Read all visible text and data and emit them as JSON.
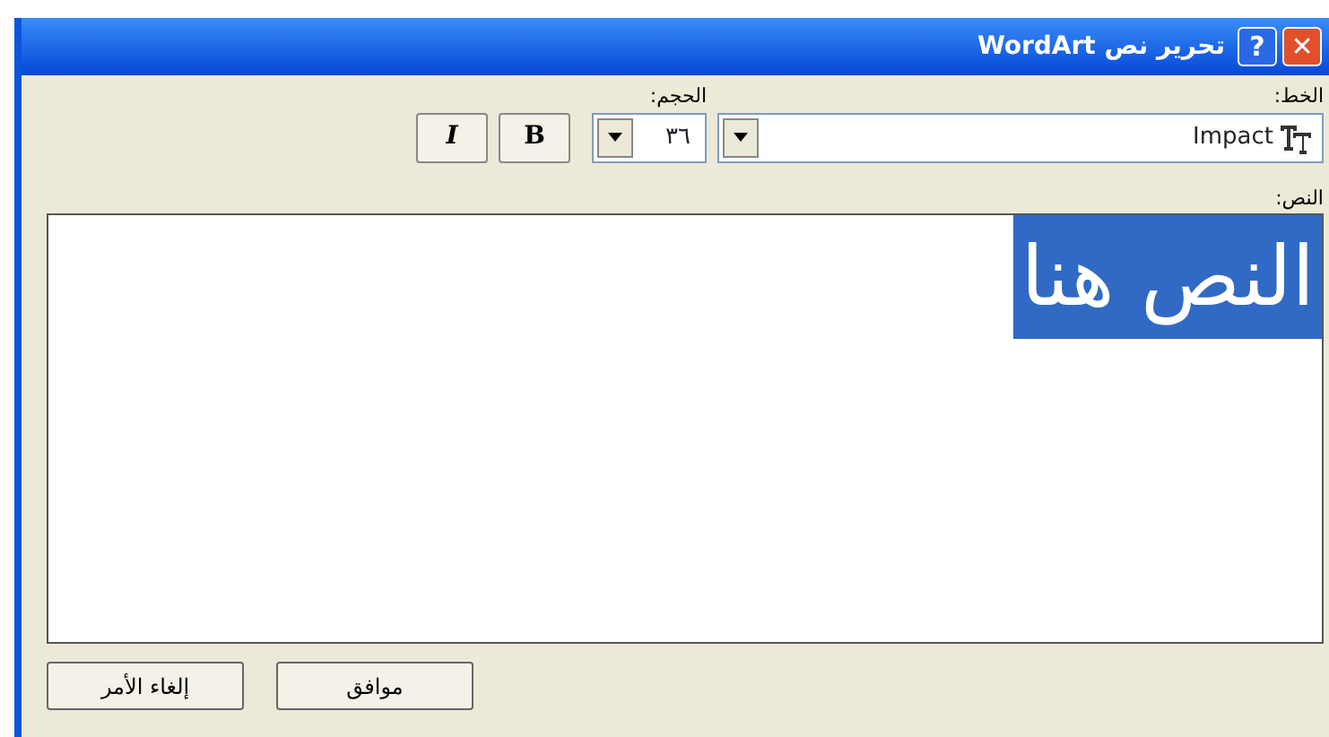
{
  "window": {
    "title": "تحرير نص WordArt",
    "buttons": [
      {
        "kind": "close",
        "symbol": "✕"
      },
      {
        "kind": "help",
        "symbol": "?"
      }
    ]
  },
  "font": {
    "label": "الخط:",
    "value": "Impact"
  },
  "size": {
    "label": "الحجم:",
    "value": "٣٦"
  },
  "style_buttons": [
    {
      "label": "B",
      "kind": "bold",
      "selected": false
    },
    {
      "label": "I",
      "kind": "italic",
      "selected": false
    }
  ],
  "text": {
    "label": "النص:",
    "value": "النص هنا",
    "selected": true
  },
  "buttons": [
    "موافق",
    "إلغاء الأمر"
  ]
}
